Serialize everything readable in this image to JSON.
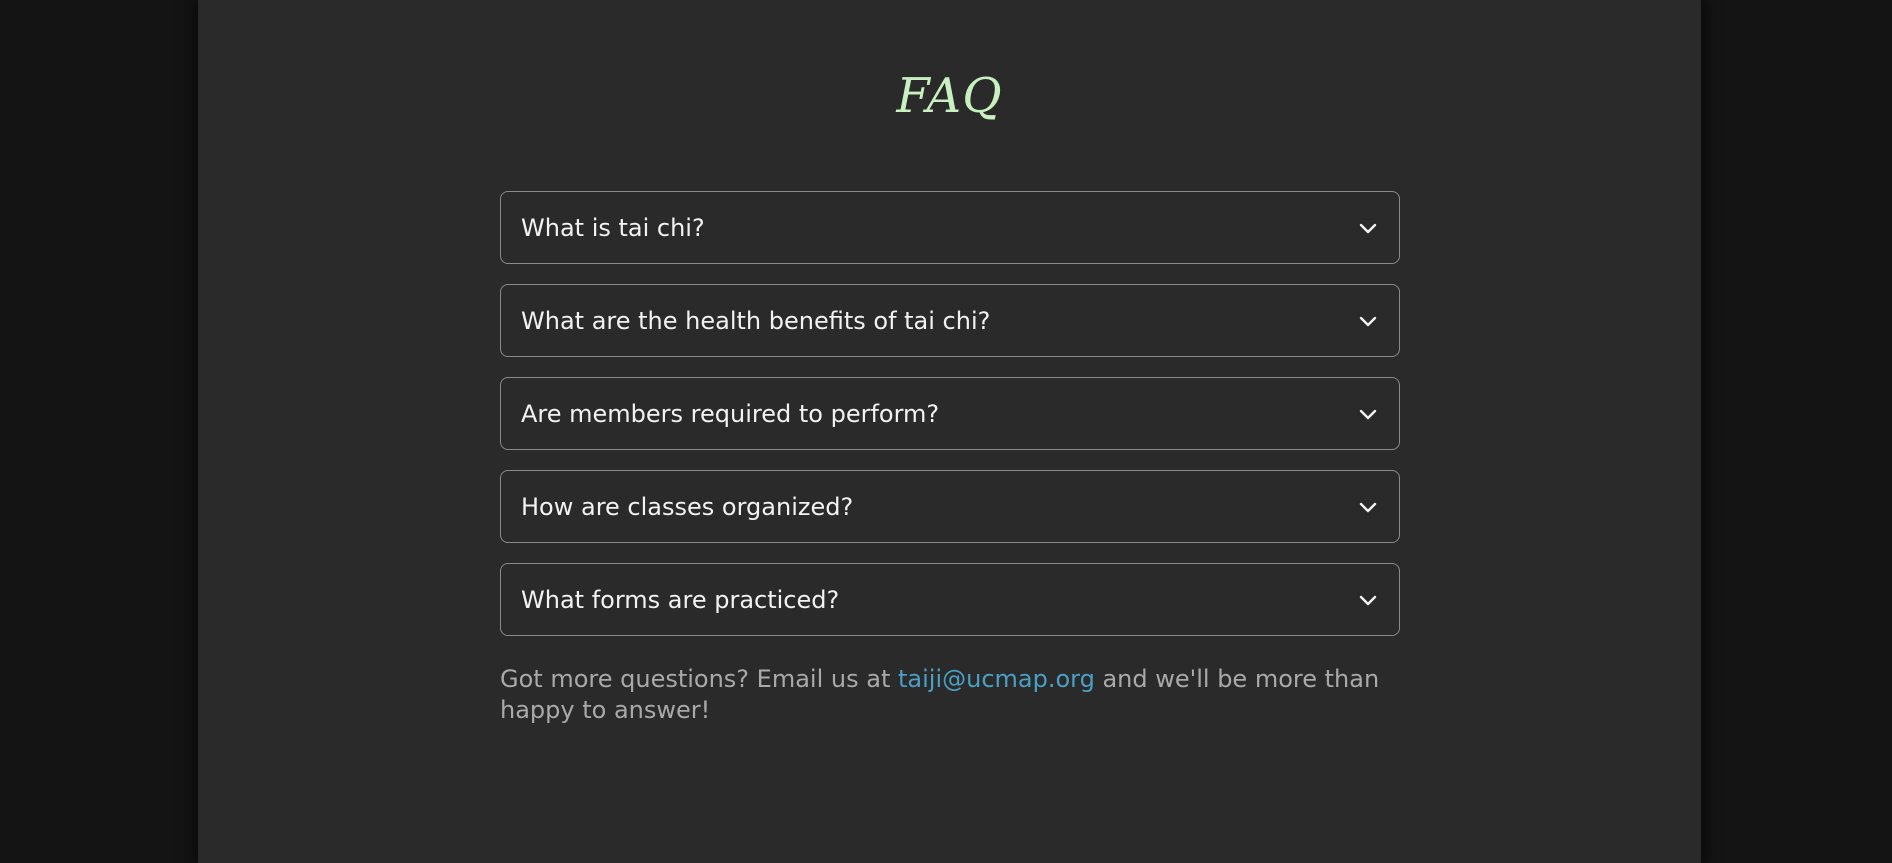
{
  "page": {
    "title": "FAQ",
    "title_color": "#c8f0c0",
    "background": "#2a2a2a"
  },
  "faq": {
    "items": [
      {
        "question": "What is tai chi?",
        "icon": "chevron-down-icon"
      },
      {
        "question": "What are the health benefits of tai chi?",
        "icon": "chevron-down-icon"
      },
      {
        "question": "Are members required to perform?",
        "icon": "chevron-down-icon"
      },
      {
        "question": "How are classes organized?",
        "icon": "chevron-down-icon"
      },
      {
        "question": "What forms are practiced?",
        "icon": "chevron-down-icon"
      }
    ]
  },
  "footer": {
    "text_before": "Got more questions? Email us at ",
    "email": "taiji@ucmap.org",
    "text_after": " and we'll be more than happy to answer!",
    "link_color": "#4a9fc4"
  }
}
